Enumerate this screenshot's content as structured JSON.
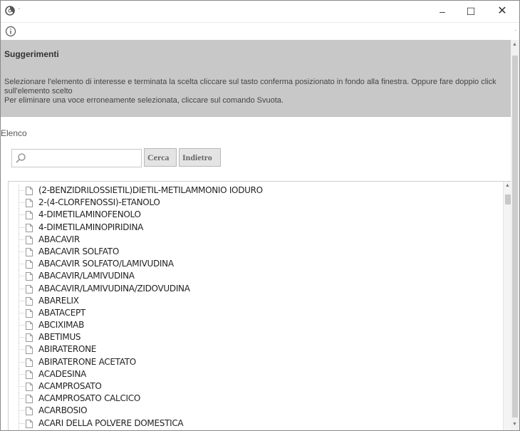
{
  "window": {
    "title": "·",
    "minimize": "–",
    "maximize": "☐",
    "close": "✕"
  },
  "infobar": {
    "dot": "."
  },
  "tips": {
    "title": "Suggerimenti",
    "line1": "Selezionare l'elemento di interesse e terminata la scelta cliccare sul tasto conferma posizionato in fondo alla finestra. Oppure fare doppio click sull'elemento scelto",
    "line2": "Per eliminare una voce erroneamente selezionata, cliccare sul comando Svuota."
  },
  "list_section": {
    "label": "Elenco",
    "search_value": "",
    "search_button": "Cerca",
    "back_button": "Indietro"
  },
  "items": [
    "(2-BENZIDRILOSSIETIL)DIETIL-METILAMMONIO IODURO",
    "2-(4-CLORFENOSSI)-ETANOLO",
    "4-DIMETILAMINOFENOLO",
    "4-DIMETILAMINOPIRIDINA",
    "ABACAVIR",
    "ABACAVIR SOLFATO",
    "ABACAVIR SOLFATO/LAMIVUDINA",
    "ABACAVIR/LAMIVUDINA",
    "ABACAVIR/LAMIVUDINA/ZIDOVUDINA",
    "ABARELIX",
    "ABATACEPT",
    "ABCIXIMAB",
    "ABETIMUS",
    "ABIRATERONE",
    "ABIRATERONE ACETATO",
    "ACADESINA",
    "ACAMPROSATO",
    "ACAMPROSATO CALCICO",
    "ACARBOSIO",
    "ACARI DELLA POLVERE DOMESTICA"
  ]
}
